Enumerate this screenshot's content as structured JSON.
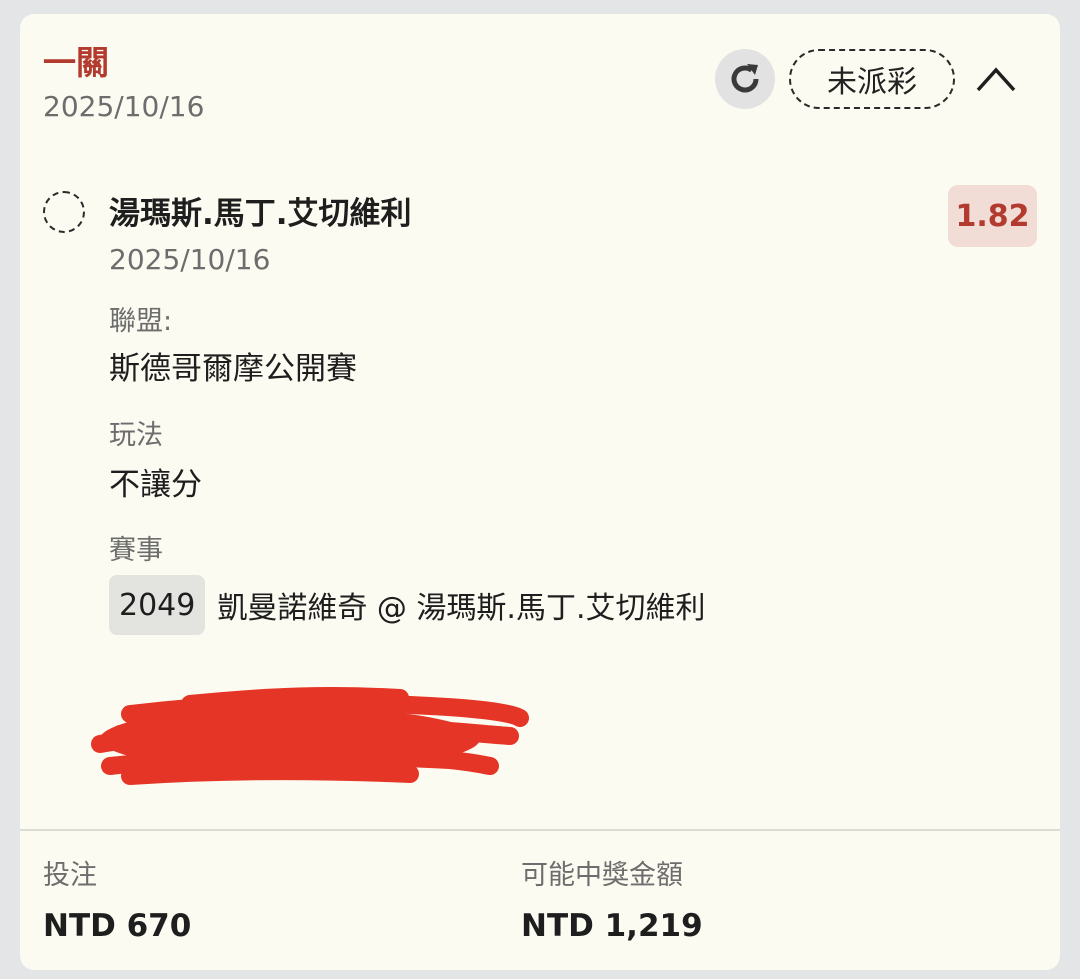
{
  "header": {
    "bet_type": "一關",
    "date": "2025/10/16",
    "status": "未派彩",
    "icons": {
      "refresh": "refresh-icon",
      "collapse": "chevron-up-icon"
    }
  },
  "selection": {
    "name": "湯瑪斯.馬丁.艾切維利",
    "date": "2025/10/16",
    "odds": "1.82",
    "fields": [
      {
        "label": "聯盟:",
        "value": "斯德哥爾摩公開賽"
      },
      {
        "label": "玩法",
        "value": "不讓分"
      },
      {
        "label": "賽事"
      }
    ],
    "event": {
      "number": "2049",
      "name": "凱曼諾維奇 @ 湯瑪斯.馬丁.艾切維利"
    }
  },
  "summary": {
    "stake_label": "投注",
    "stake_value": "NTD 670",
    "payout_label": "可能中獎金額",
    "payout_value": "NTD 1,219"
  },
  "colors": {
    "accent": "#b23a2f",
    "card_background": "#fcfbf1",
    "odds_background": "#f1dcd6",
    "redaction": "#e53526"
  }
}
